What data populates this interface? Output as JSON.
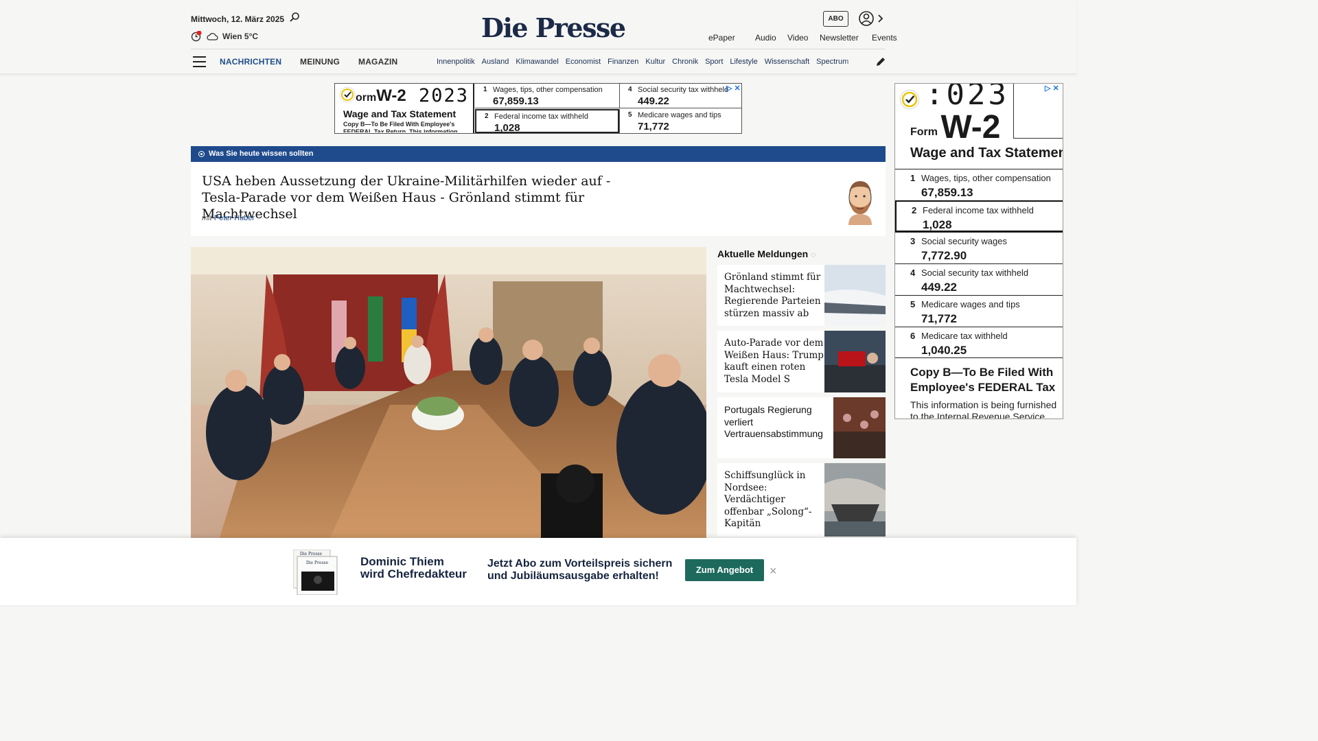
{
  "header": {
    "date": "Mittwoch, 12. März 2025",
    "weather": "Wien 5°C",
    "logo": "Die Presse",
    "abo_label": "ABO",
    "top_links": [
      "ePaper",
      "Audio",
      "Video",
      "Newsletter",
      "Events"
    ],
    "main_nav": [
      "NACHRICHTEN",
      "MEINUNG",
      "MAGAZIN"
    ],
    "sub_nav": [
      "Innenpolitik",
      "Ausland",
      "Klimawandel",
      "Economist",
      "Finanzen",
      "Kultur",
      "Chronik",
      "Sport",
      "Lifestyle",
      "Wissenschaft",
      "Spectrum"
    ],
    "icons": [
      "search-icon",
      "notification-icon",
      "cloud-icon",
      "user-icon",
      "chevron-right-icon",
      "menu-icon",
      "pencil-icon"
    ],
    "colors": {
      "brand_navy": "#1c2a48",
      "nav_blue": "#1f4e8c",
      "live_bar": "#1f4b8c",
      "notification_dot": "#e2211c"
    }
  },
  "ad_top": {
    "form_prefix": "orm",
    "form_code": "W-2",
    "year": "2023",
    "title": "Wage and Tax Statement",
    "copy": "Copy B—To Be Filed With Employee's FEDERAL Tax Return. This information",
    "boxes": [
      {
        "num": "1",
        "label": "Wages, tips, other compensation",
        "value": "67,859.13"
      },
      {
        "num": "4",
        "label": "Social security tax withheld",
        "value": "449.22"
      },
      {
        "num": "2",
        "label": "Federal income tax withheld",
        "value": "1,028"
      },
      {
        "num": "5",
        "label": "Medicare wages and tips",
        "value": "71,772"
      }
    ]
  },
  "ad_side": {
    "year": ":023",
    "form_prefix": "Form",
    "form_code": "W-2",
    "title": "Wage and Tax Statemen",
    "boxes": [
      {
        "num": "1",
        "label": "Wages, tips, other compensation",
        "value": "67,859.13"
      },
      {
        "num": "2",
        "label": "Federal income tax withheld",
        "value": "1,028"
      },
      {
        "num": "3",
        "label": "Social security wages",
        "value": "7,772.90"
      },
      {
        "num": "4",
        "label": "Social security tax withheld",
        "value": "449.22"
      },
      {
        "num": "5",
        "label": "Medicare wages and tips",
        "value": "71,772"
      },
      {
        "num": "6",
        "label": "Medicare tax withheld",
        "value": "1,040.25"
      }
    ],
    "copy_line1": "Copy B—To Be Filed With",
    "copy_line2": "Employee's FEDERAL Tax",
    "info_line1": "This information is being furnished",
    "info_line2": "to the Internal Revenue Service"
  },
  "live": {
    "label": "Was Sie heute wissen sollten",
    "title": "USA heben Aussetzung der Ukraine-Militärhilfen wieder auf - Tesla-Parade vor dem Weißen Haus - Grönland stimmt für Machtwechsel",
    "author_prefix": "mit",
    "author": "Peter Huber"
  },
  "news": {
    "heading": "Aktuelle Meldungen",
    "items": [
      {
        "title": "Grönland stimmt für Machtwechsel: Regierende Parteien stürzen massiv ab"
      },
      {
        "title": "Auto-Parade vor dem Weißen Haus: Trump kauft einen roten Tesla Model S"
      },
      {
        "title": "Portugals Regierung verliert Vertrauensabstimmung"
      },
      {
        "title": "Schiffsunglück in Nordsee: Verdächtiger offenbar „Solong“-Kapitän"
      }
    ]
  },
  "promo": {
    "paper_label": "Die Presse",
    "name_line1": "Dominic Thiem",
    "name_line2": "wird Chefredakteur",
    "text_line1": "Jetzt Abo zum Vorteilspreis sichern",
    "text_line2": "und Jubiläumsausgabe erhalten!",
    "cta": "Zum Angebot",
    "close": "×"
  }
}
